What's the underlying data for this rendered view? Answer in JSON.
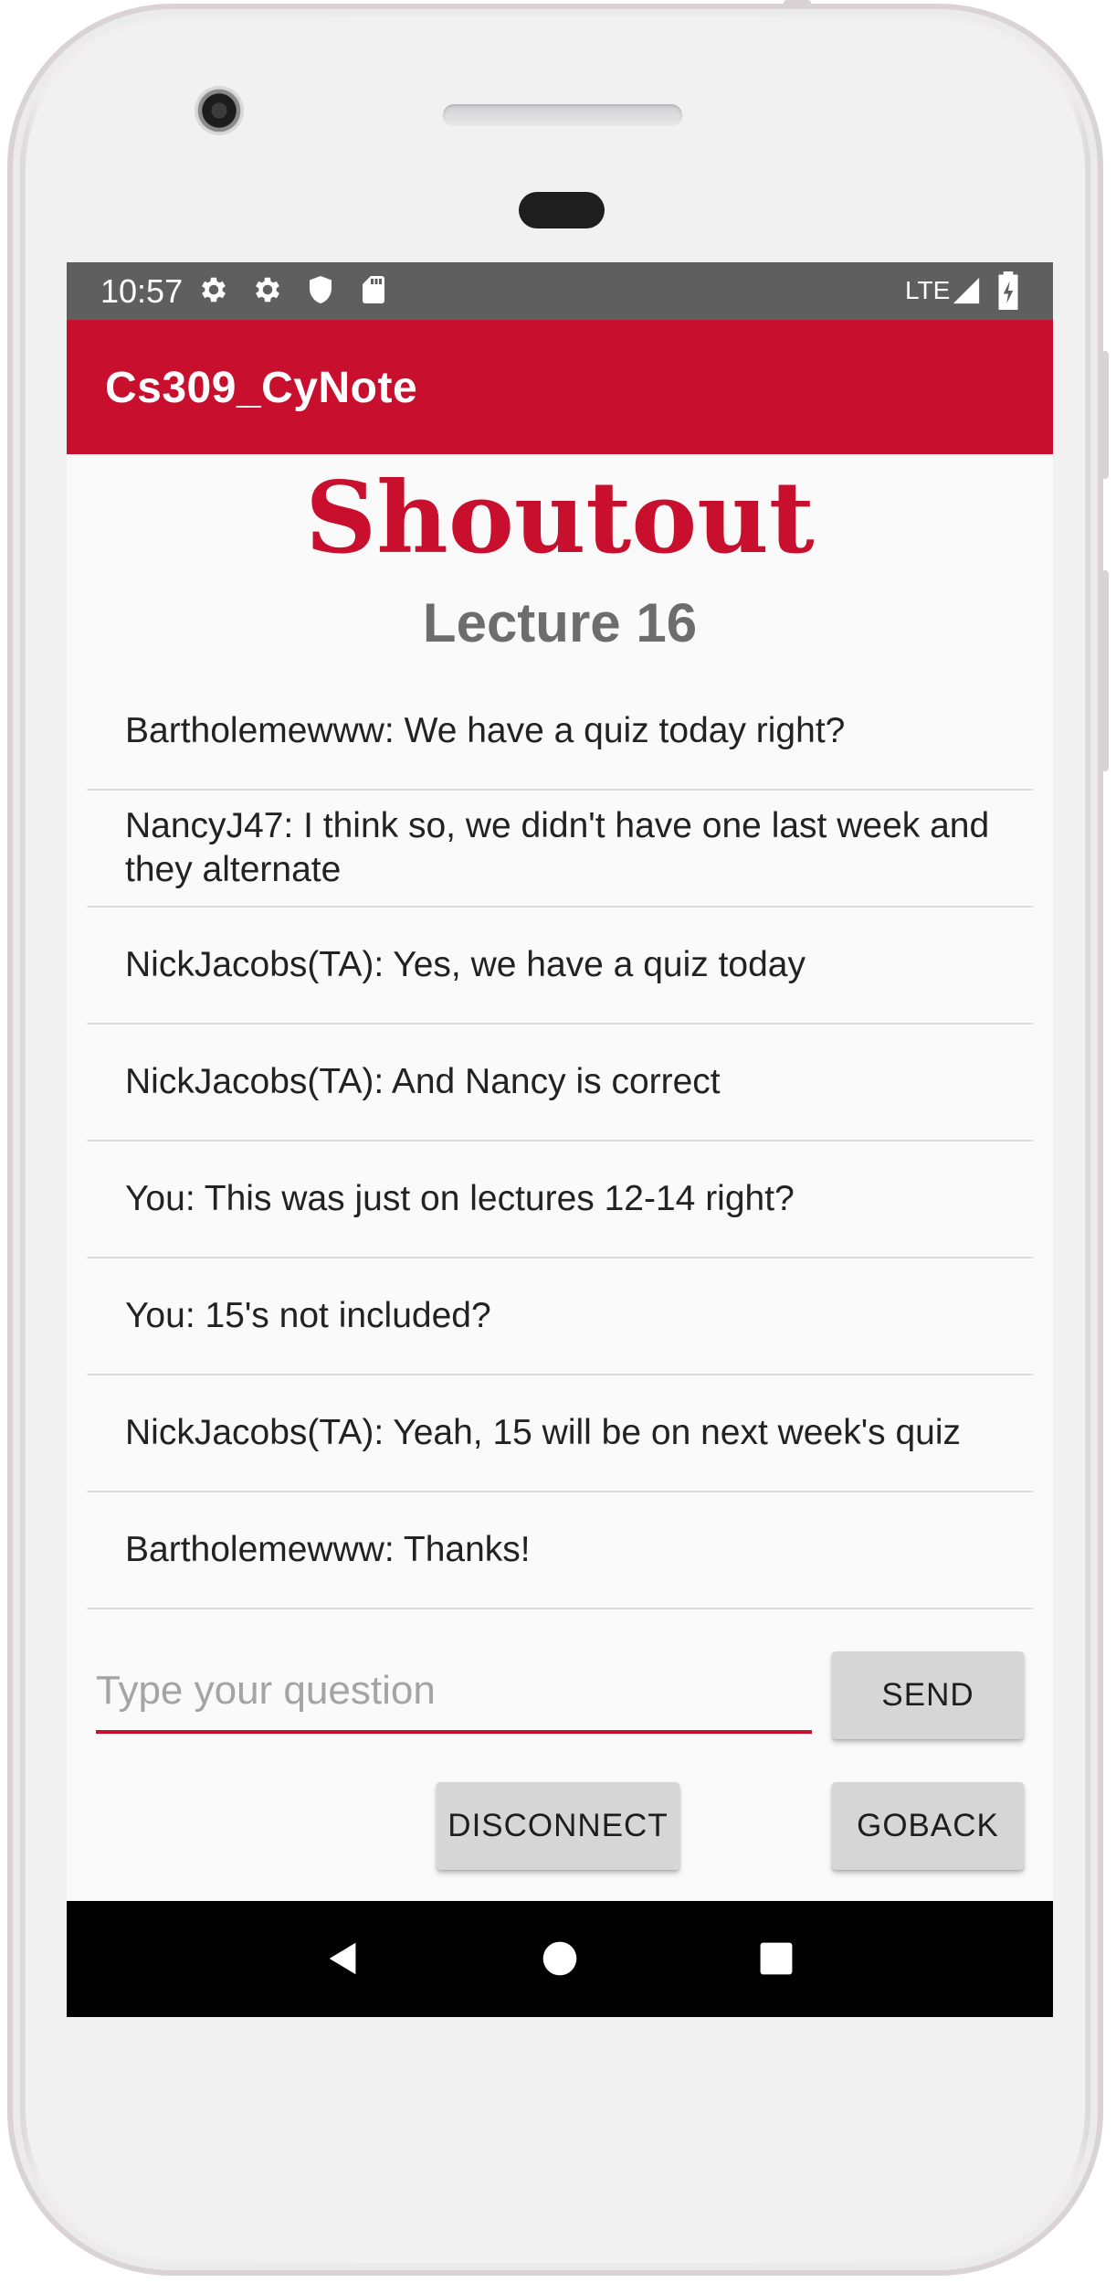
{
  "status_bar": {
    "time": "10:57",
    "left_icons": [
      "gear-icon",
      "gear-icon",
      "shield-icon",
      "sd-card-icon"
    ],
    "network": "LTE",
    "right_icons": [
      "signal-icon",
      "battery-charging-icon"
    ]
  },
  "app_bar": {
    "title": "Cs309_CyNote",
    "color": "#c8102e"
  },
  "header": {
    "title": "Shoutout",
    "subtitle": "Lecture 16"
  },
  "messages": [
    {
      "text": "Bartholemewww: We have a quiz today right?"
    },
    {
      "text": "NancyJ47: I think so, we didn't have one last week and they alternate"
    },
    {
      "text": "NickJacobs(TA): Yes, we have a quiz today"
    },
    {
      "text": "NickJacobs(TA): And Nancy is correct"
    },
    {
      "text": "You: This was just on lectures 12-14 right?"
    },
    {
      "text": "You: 15's not included?"
    },
    {
      "text": "NickJacobs(TA): Yeah, 15 will be on next week's quiz"
    },
    {
      "text": "Bartholemewww: Thanks!"
    }
  ],
  "composer": {
    "placeholder": "Type your question",
    "value": "",
    "send_label": "SEND"
  },
  "actions": {
    "disconnect_label": "DISCONNECT",
    "goback_label": "GOBACK"
  },
  "nav_bar": {
    "buttons": [
      "back-icon",
      "home-icon",
      "recents-icon"
    ]
  }
}
